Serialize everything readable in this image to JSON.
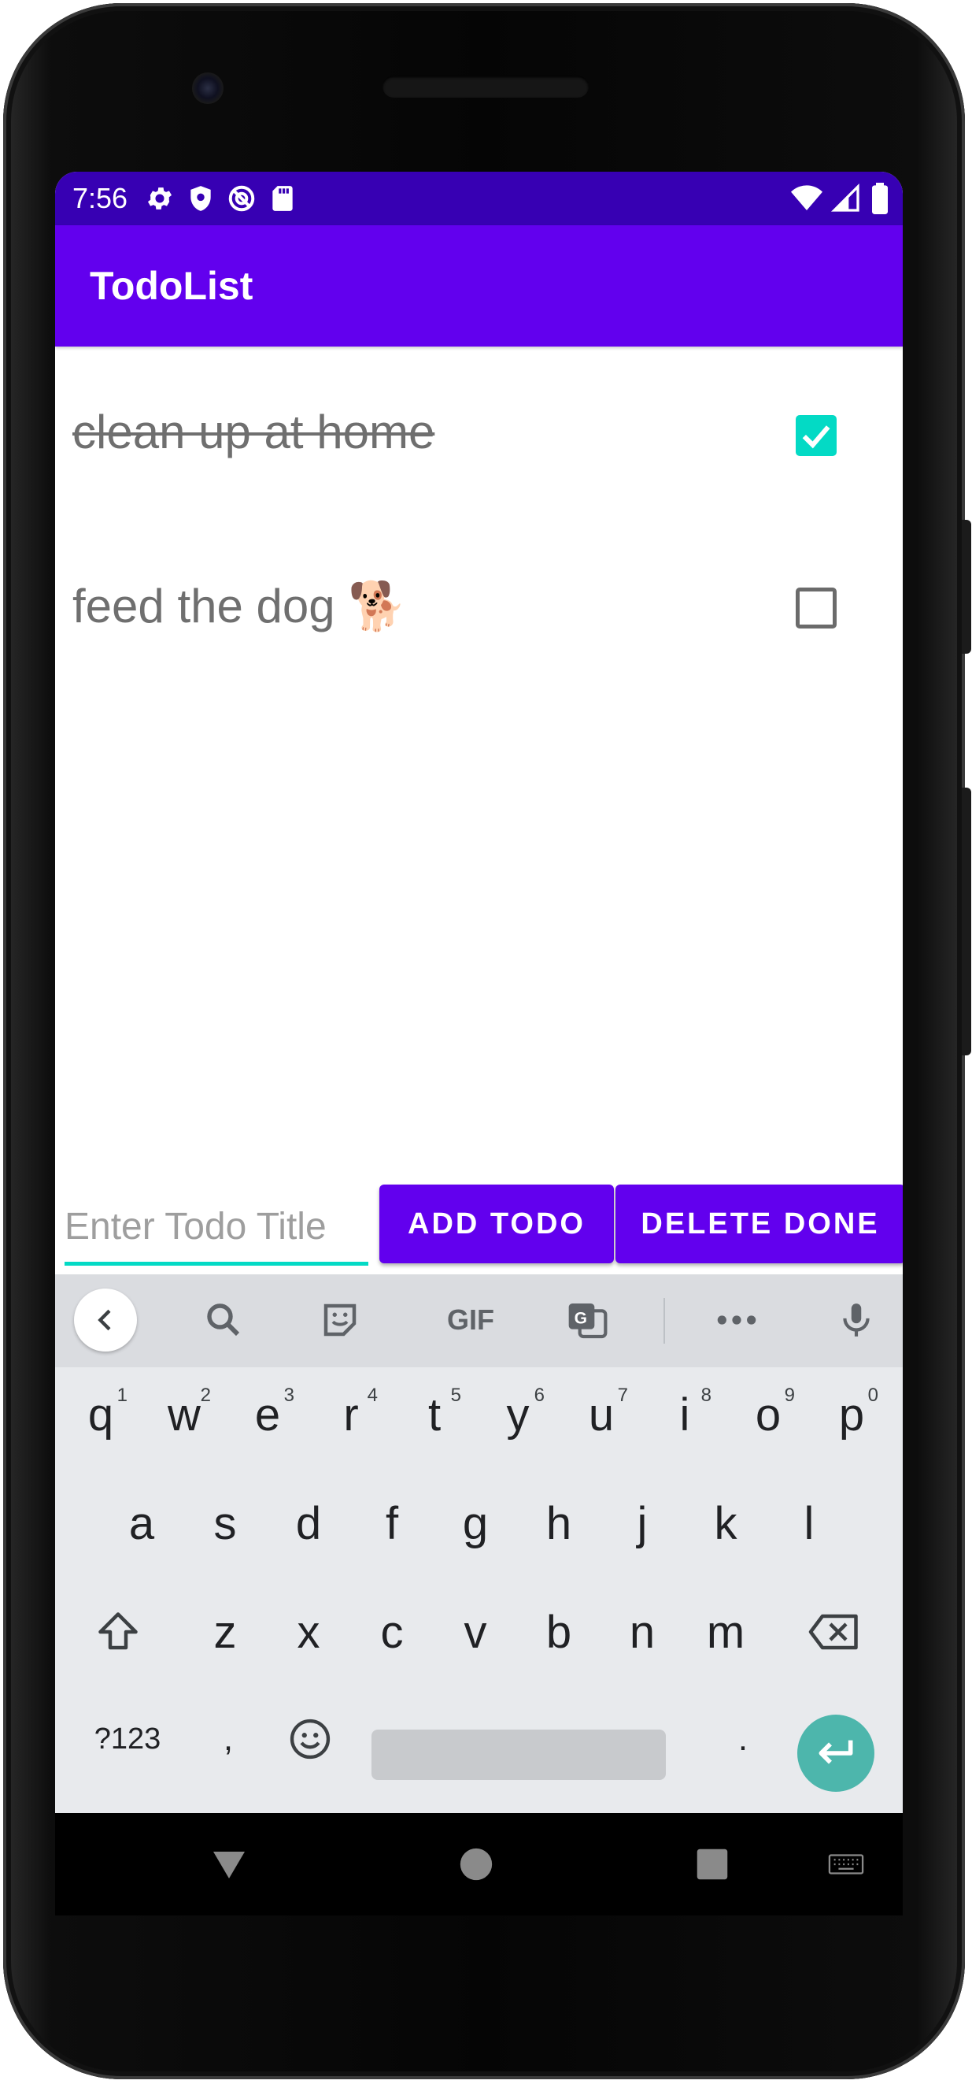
{
  "status_bar": {
    "time": "7:56",
    "icons": [
      "gear-icon",
      "shield-icon",
      "at-sign-icon",
      "sd-card-icon",
      "wifi-icon",
      "cell-signal-icon",
      "battery-icon"
    ]
  },
  "app_bar": {
    "title": "TodoList"
  },
  "todos": [
    {
      "text": "clean up at home",
      "done": true
    },
    {
      "text": "feed the dog 🐕",
      "done": false
    }
  ],
  "input": {
    "placeholder": "Enter Todo Title",
    "value": ""
  },
  "buttons": {
    "add_label": "ADD TODO",
    "delete_label": "DELETE DONE"
  },
  "keyboard": {
    "toolbar": [
      "back-icon",
      "search-icon",
      "sticker-icon",
      "gif-icon",
      "translate-icon",
      "more-icon",
      "mic-icon"
    ],
    "gif_label": "GIF",
    "row1": [
      {
        "key": "q",
        "hint": "1"
      },
      {
        "key": "w",
        "hint": "2"
      },
      {
        "key": "e",
        "hint": "3"
      },
      {
        "key": "r",
        "hint": "4"
      },
      {
        "key": "t",
        "hint": "5"
      },
      {
        "key": "y",
        "hint": "6"
      },
      {
        "key": "u",
        "hint": "7"
      },
      {
        "key": "i",
        "hint": "8"
      },
      {
        "key": "o",
        "hint": "9"
      },
      {
        "key": "p",
        "hint": "0"
      }
    ],
    "row2": [
      "a",
      "s",
      "d",
      "f",
      "g",
      "h",
      "j",
      "k",
      "l"
    ],
    "row3": [
      "z",
      "x",
      "c",
      "v",
      "b",
      "n",
      "m"
    ],
    "row4": {
      "symbols": "?123",
      "comma": ",",
      "period": "."
    }
  },
  "colors": {
    "primary": "#6200ee",
    "primary_dark": "#3700b3",
    "accent": "#03dac5",
    "enter_key": "#4db6ac",
    "keyboard_bg": "#e8eaed"
  }
}
